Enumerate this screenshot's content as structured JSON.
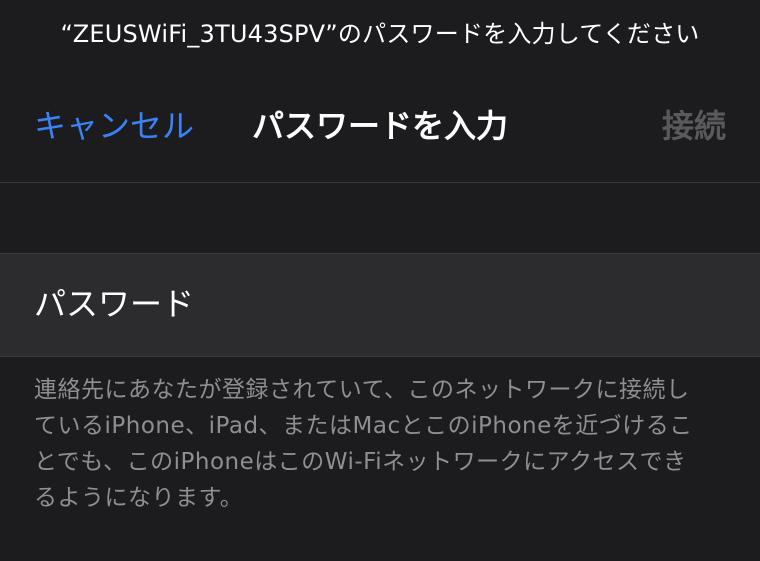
{
  "prompt": {
    "text": "“ZEUSWiFi_3TU43SPV”のパスワードを入力してください"
  },
  "nav": {
    "cancel_label": "キャンセル",
    "title": "パスワードを入力",
    "connect_label": "接続"
  },
  "password_field": {
    "label": "パスワード",
    "value": ""
  },
  "footer": {
    "lines": [
      "連絡先にあなたが登録されていて、このネットワークに接続し",
      "ているiPhone、iPad、またはMacとこのiPhoneを近づけるこ",
      "とでも、このiPhoneはこのWi-Fiネットワークにアクセスでき",
      "るようになります。"
    ]
  },
  "colors": {
    "background": "#1c1c1e",
    "field_background": "#2c2c2e",
    "accent": "#3b82f6",
    "disabled": "#5a5a5e",
    "secondary_text": "#8e8e93"
  }
}
